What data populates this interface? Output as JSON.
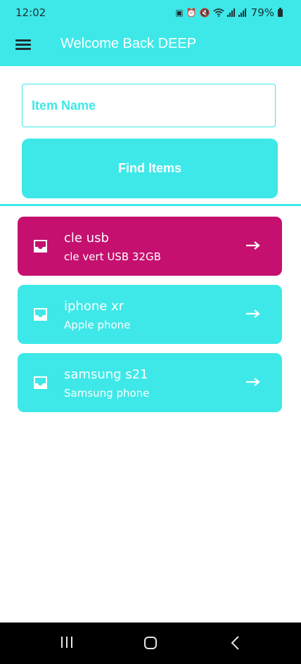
{
  "status_bar": {
    "time": "12:02",
    "battery": "79%",
    "icons": [
      "sim-icon",
      "alarm-icon",
      "mute-icon",
      "wifi-icon",
      "signal-icon",
      "signal-icon",
      "battery-icon"
    ]
  },
  "app_bar": {
    "title": "Welcome Back DEEP",
    "menu_icon": "hamburger-menu-icon"
  },
  "search": {
    "placeholder": "Item Name",
    "value": ""
  },
  "find_button": {
    "label": "Find Items"
  },
  "items": [
    {
      "title": "cle usb",
      "subtitle": "cle vert USB 32GB",
      "icon": "inbox-icon",
      "trailing_icon": "arrow-right-icon",
      "color": "#c5106f"
    },
    {
      "title": "iphone xr",
      "subtitle": "Apple phone",
      "icon": "inbox-icon",
      "trailing_icon": "arrow-right-icon",
      "color": "#3ee8e8"
    },
    {
      "title": "samsung s21",
      "subtitle": "Samsung phone",
      "icon": "inbox-icon",
      "trailing_icon": "arrow-right-icon",
      "color": "#3ee8e8"
    }
  ],
  "nav_bar": {
    "icons": [
      "recents-icon",
      "home-icon",
      "back-icon"
    ]
  },
  "colors": {
    "accent": "#3ee8e8",
    "selected": "#c5106f",
    "text_on_accent": "#ffffff",
    "nav_bar": "#000000"
  }
}
